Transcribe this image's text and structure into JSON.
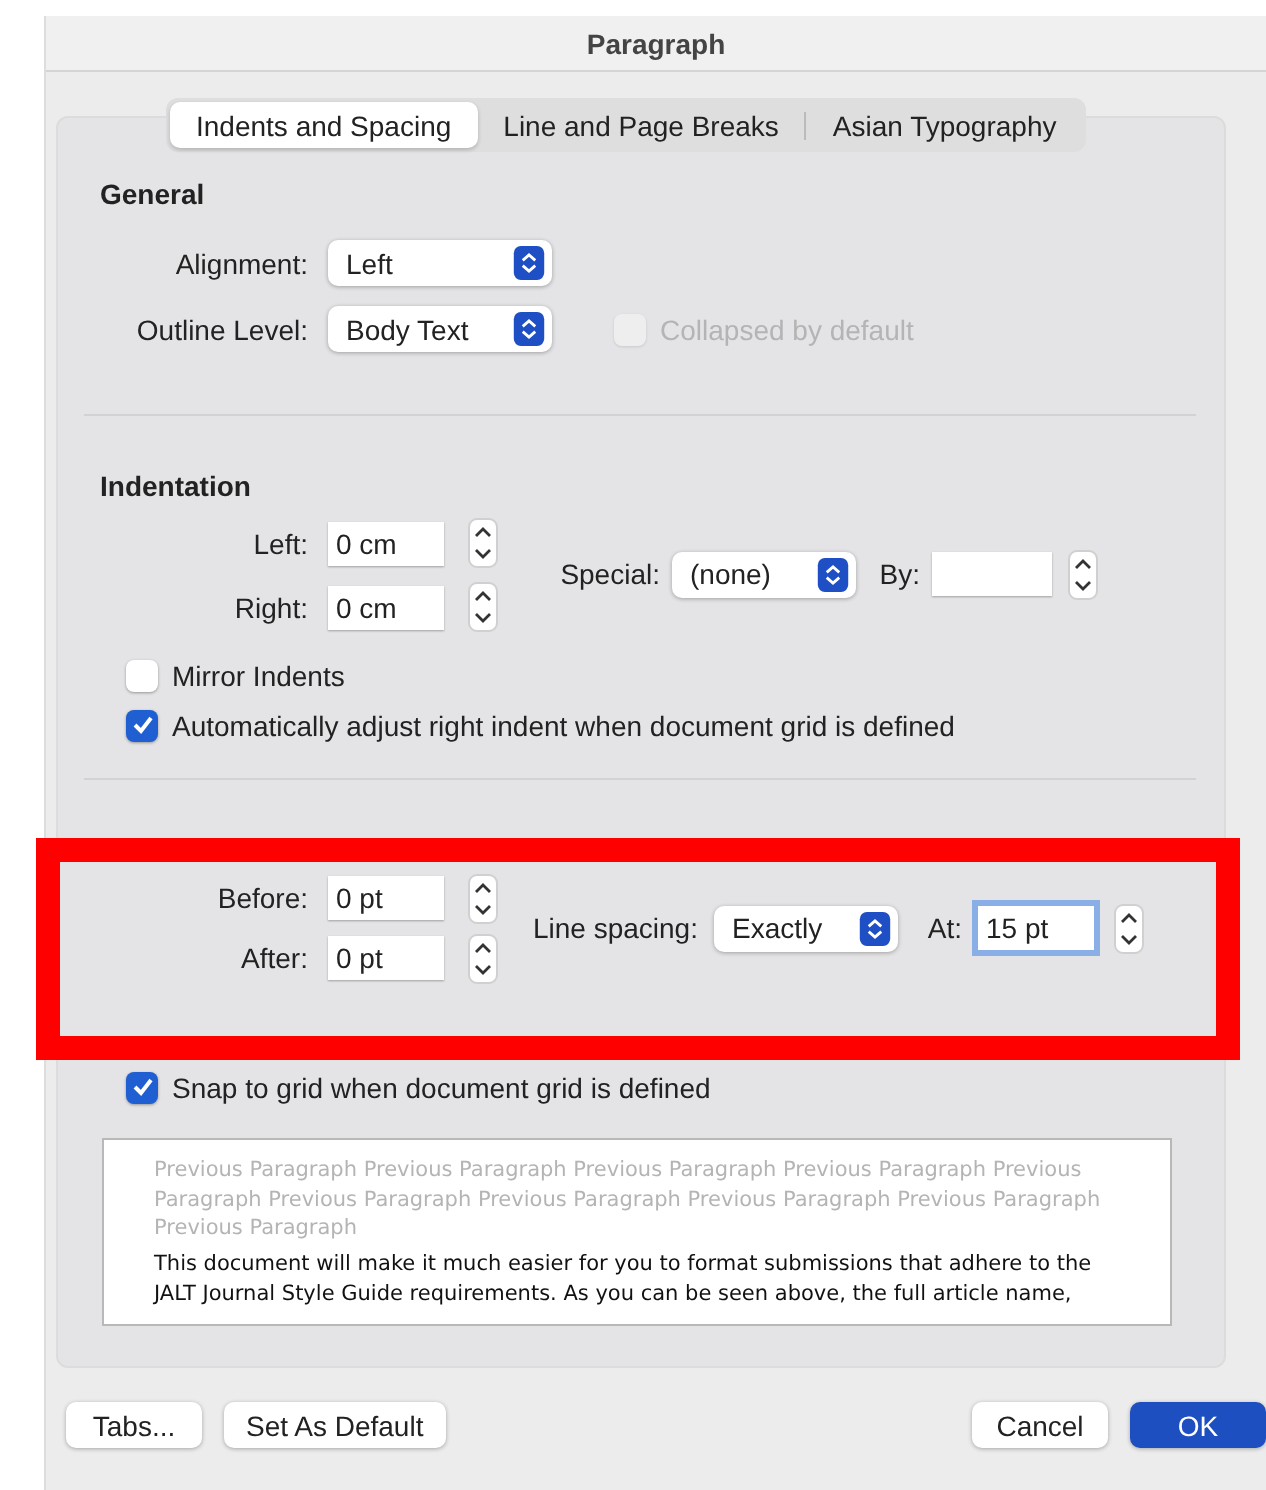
{
  "window": {
    "title": "Paragraph"
  },
  "tabs": [
    {
      "label": "Indents and Spacing",
      "selected": true
    },
    {
      "label": "Line and Page Breaks",
      "selected": false
    },
    {
      "label": "Asian Typography",
      "selected": false
    }
  ],
  "general": {
    "heading": "General",
    "alignment": {
      "label": "Alignment:",
      "value": "Left"
    },
    "outline_level": {
      "label": "Outline Level:",
      "value": "Body Text"
    },
    "collapsed": {
      "label": "Collapsed by default",
      "checked": false,
      "disabled": true
    }
  },
  "indentation": {
    "heading": "Indentation",
    "left": {
      "label": "Left:",
      "value": "0 cm"
    },
    "right": {
      "label": "Right:",
      "value": "0 cm"
    },
    "special": {
      "label": "Special:",
      "value": "(none)"
    },
    "by": {
      "label": "By:"
    },
    "checkboxes": [
      {
        "label": "Mirror Indents",
        "checked": false
      },
      {
        "label": "Automatically adjust right indent when document grid is defined",
        "checked": true
      }
    ]
  },
  "spacing": {
    "before": {
      "label": "Before:",
      "value": "0 pt"
    },
    "after": {
      "label": "After:",
      "value": "0 pt"
    },
    "line_spacing": {
      "label": "Line spacing:",
      "value": "Exactly"
    },
    "at": {
      "label": "At:",
      "value": "15 pt",
      "focused": true
    },
    "checkboxes": [
      {
        "label": "Snap to grid when document grid is defined",
        "checked": true
      }
    ]
  },
  "preview": {
    "previous": "Previous Paragraph Previous Paragraph Previous Paragraph Previous Paragraph Previous Paragraph Previous Paragraph Previous Paragraph Previous Paragraph Previous Paragraph Previous Paragraph",
    "current": "This document will make it much easier for you to format submissions that adhere to the JALT Journal Style Guide requirements. As you can be seen above, the full article name,"
  },
  "buttons_left": [
    {
      "label": "Tabs...",
      "kind": "normal"
    },
    {
      "label": "Set As Default",
      "kind": "normal"
    }
  ],
  "buttons_right": [
    {
      "label": "Cancel",
      "kind": "normal"
    },
    {
      "label": "OK",
      "kind": "primary"
    }
  ]
}
